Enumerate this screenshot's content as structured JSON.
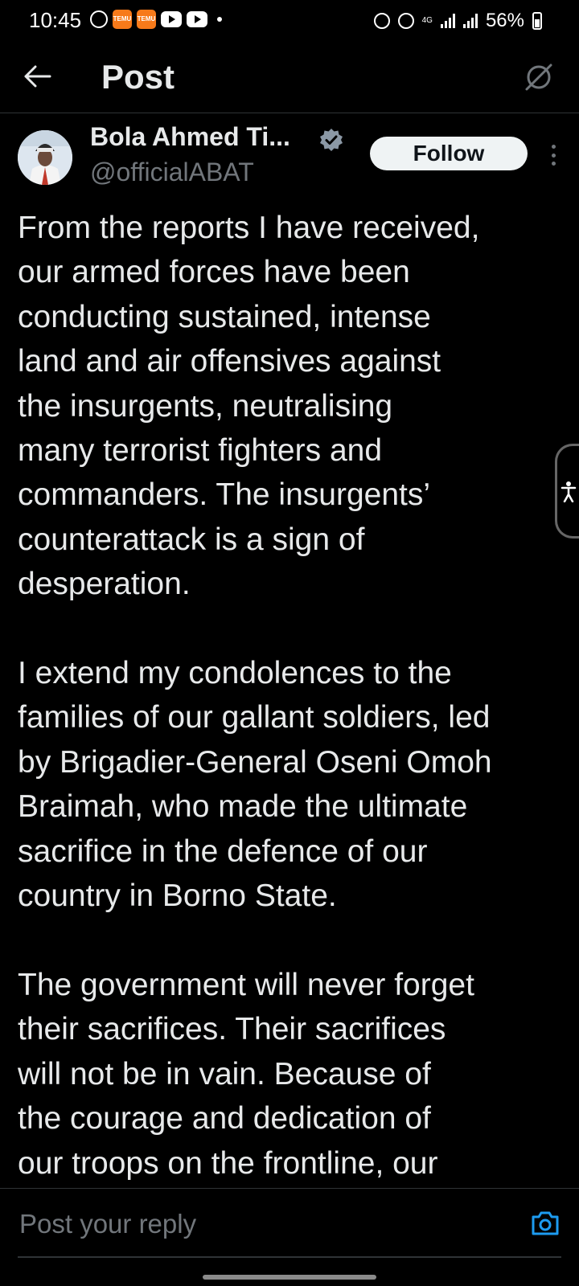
{
  "status_bar": {
    "time": "10:45",
    "app_icon_label": "TEMU",
    "network": "4G",
    "battery": "56%"
  },
  "header": {
    "title": "Post"
  },
  "post": {
    "author_name": "Bola Ahmed Ti...",
    "author_handle": "@officialABAT",
    "follow_label": "Follow",
    "paragraphs": [
      "From the reports I have received,\nour armed forces have been\nconducting sustained, intense\nland and air offensives against\nthe insurgents, neutralising\nmany terrorist fighters and\ncommanders. The insurgents’\ncounterattack is a sign of\ndesperation.",
      "I extend my condolences to the\nfamilies of our gallant soldiers, led\nby  Brigadier-General Oseni Omoh\nBraimah, who made the ultimate\nsacrifice in the defence of our\ncountry in Borno State.",
      "The government will never forget\ntheir sacrifices. Their sacrifices\nwill not be in vain. Because of\nthe courage and dedication of\nour troops on the frontline, our"
    ]
  },
  "reply": {
    "placeholder": "Post your reply"
  },
  "colors": {
    "background": "#000000",
    "text": "#e7e9ea",
    "secondary_text": "#71767b",
    "verified_badge": "#8b98a5",
    "accent": "#1d9bf0"
  }
}
